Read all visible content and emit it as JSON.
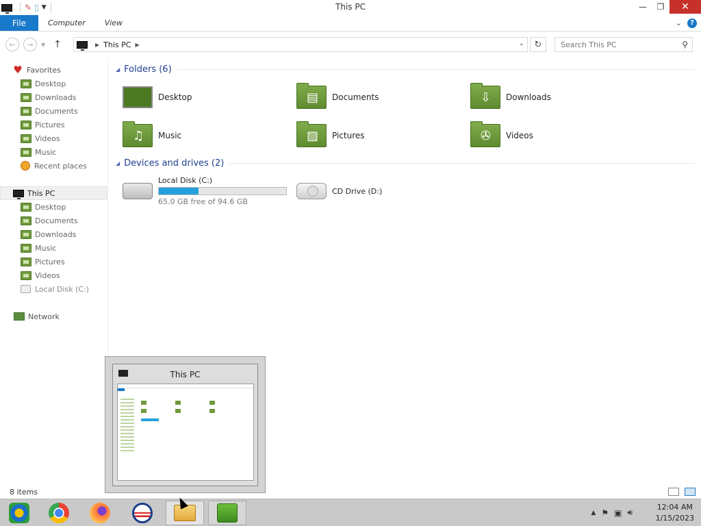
{
  "window": {
    "title": "This PC"
  },
  "ribbon": {
    "file": "File",
    "tabs": [
      "Computer",
      "View"
    ]
  },
  "address": {
    "location": "This PC"
  },
  "search": {
    "placeholder": "Search This PC"
  },
  "sidebar": {
    "favorites_label": "Favorites",
    "favorites": [
      "Desktop",
      "Downloads",
      "Documents",
      "Pictures",
      "Videos",
      "Music",
      "Recent places"
    ],
    "thispc_label": "This PC",
    "thispc": [
      "Desktop",
      "Documents",
      "Downloads",
      "Music",
      "Pictures",
      "Videos",
      "Local Disk (C:)"
    ],
    "network_label": "Network"
  },
  "main": {
    "folders_header": "Folders (6)",
    "folders": [
      "Desktop",
      "Documents",
      "Downloads",
      "Music",
      "Pictures",
      "Videos"
    ],
    "devices_header": "Devices and drives (2)",
    "drives": [
      {
        "name": "Local Disk (C:)",
        "free": "65.0 GB free of 94.6 GB",
        "used_fraction": 0.313
      },
      {
        "name": "CD Drive (D:)"
      }
    ]
  },
  "preview": {
    "title": "This PC"
  },
  "status": {
    "count": "8 items"
  },
  "taskbar": {
    "apps": [
      "media-player",
      "chrome",
      "firefox",
      "obama-logo",
      "file-explorer",
      "network-admin"
    ]
  },
  "clock": {
    "time": "12:04 AM",
    "date": "1/15/2023"
  },
  "colors": {
    "accent": "#1979ca",
    "close": "#c7312b",
    "folder": "#6f9a3b",
    "progress": "#26a0da"
  }
}
